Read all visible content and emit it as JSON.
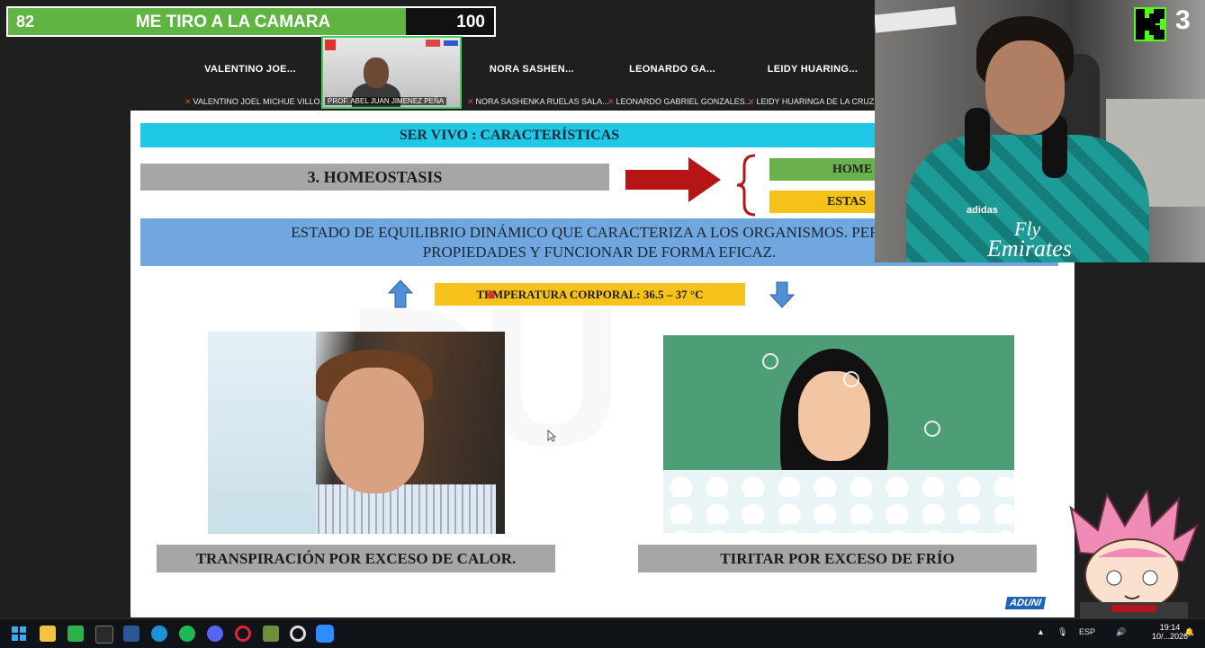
{
  "stream": {
    "progress_left": "82",
    "progress_title": "ME TIRO A LA CAMARA",
    "progress_right": "100",
    "progress_fraction": 0.82,
    "viewer_count": "3",
    "accent": "#5fb442",
    "kick_color": "#53fc18"
  },
  "zoom": {
    "participants": [
      {
        "name": "VALENTINO JOE...",
        "tag": "VALENTINO JOEL MICHUE VILLO..."
      },
      {
        "name": "NORA SASHEN...",
        "tag": "NORA SASHENKA RUELAS SALA..."
      },
      {
        "name": "LEONARDO GA...",
        "tag": "LEONARDO GABRIEL GONZALES..."
      },
      {
        "name": "LEIDY HUARING...",
        "tag": "LEIDY HUARINGA DE LA CRUZ"
      }
    ],
    "active_speaker_tag": "PROF. ABEL JUAN JIMENEZ PEÑA"
  },
  "slide": {
    "header": "SER VIVO : CARACTERÍSTICAS",
    "topic": "3. HOMEOSTASIS",
    "pill_green": "HOME",
    "pill_yellow": "ESTAS",
    "definition_line1": "ESTADO DE EQUILIBRIO DINÁMICO QUE CARACTERIZA A LOS ORGANISMOS. PERMIT",
    "definition_line2": "PROPIEDADES Y FUNCIONAR DE FORMA EFICAZ.",
    "temperature": "TEMPERATURA CORPORAL: 36.5 – 37 °C",
    "caption_left": "TRANSPIRACIÓN POR EXCESO DE CALOR.",
    "caption_right": "TIRITAR POR EXCESO DE FRÍO",
    "brand": "ADUNI"
  },
  "webcam": {
    "sponsor_top": "Fly",
    "sponsor_bottom": "Emirates",
    "jersey_brand": "adidas"
  },
  "taskbar": {
    "language": "ESP",
    "time": "19:14",
    "date": "10/...2026",
    "icons": [
      "windows-start-icon",
      "file-explorer-icon",
      "feedly-icon",
      "epic-games-icon",
      "word-icon",
      "edge-icon",
      "spotify-icon",
      "discord-icon",
      "opera-icon",
      "minecraft-icon",
      "chrome-icon",
      "zoom-icon"
    ]
  }
}
